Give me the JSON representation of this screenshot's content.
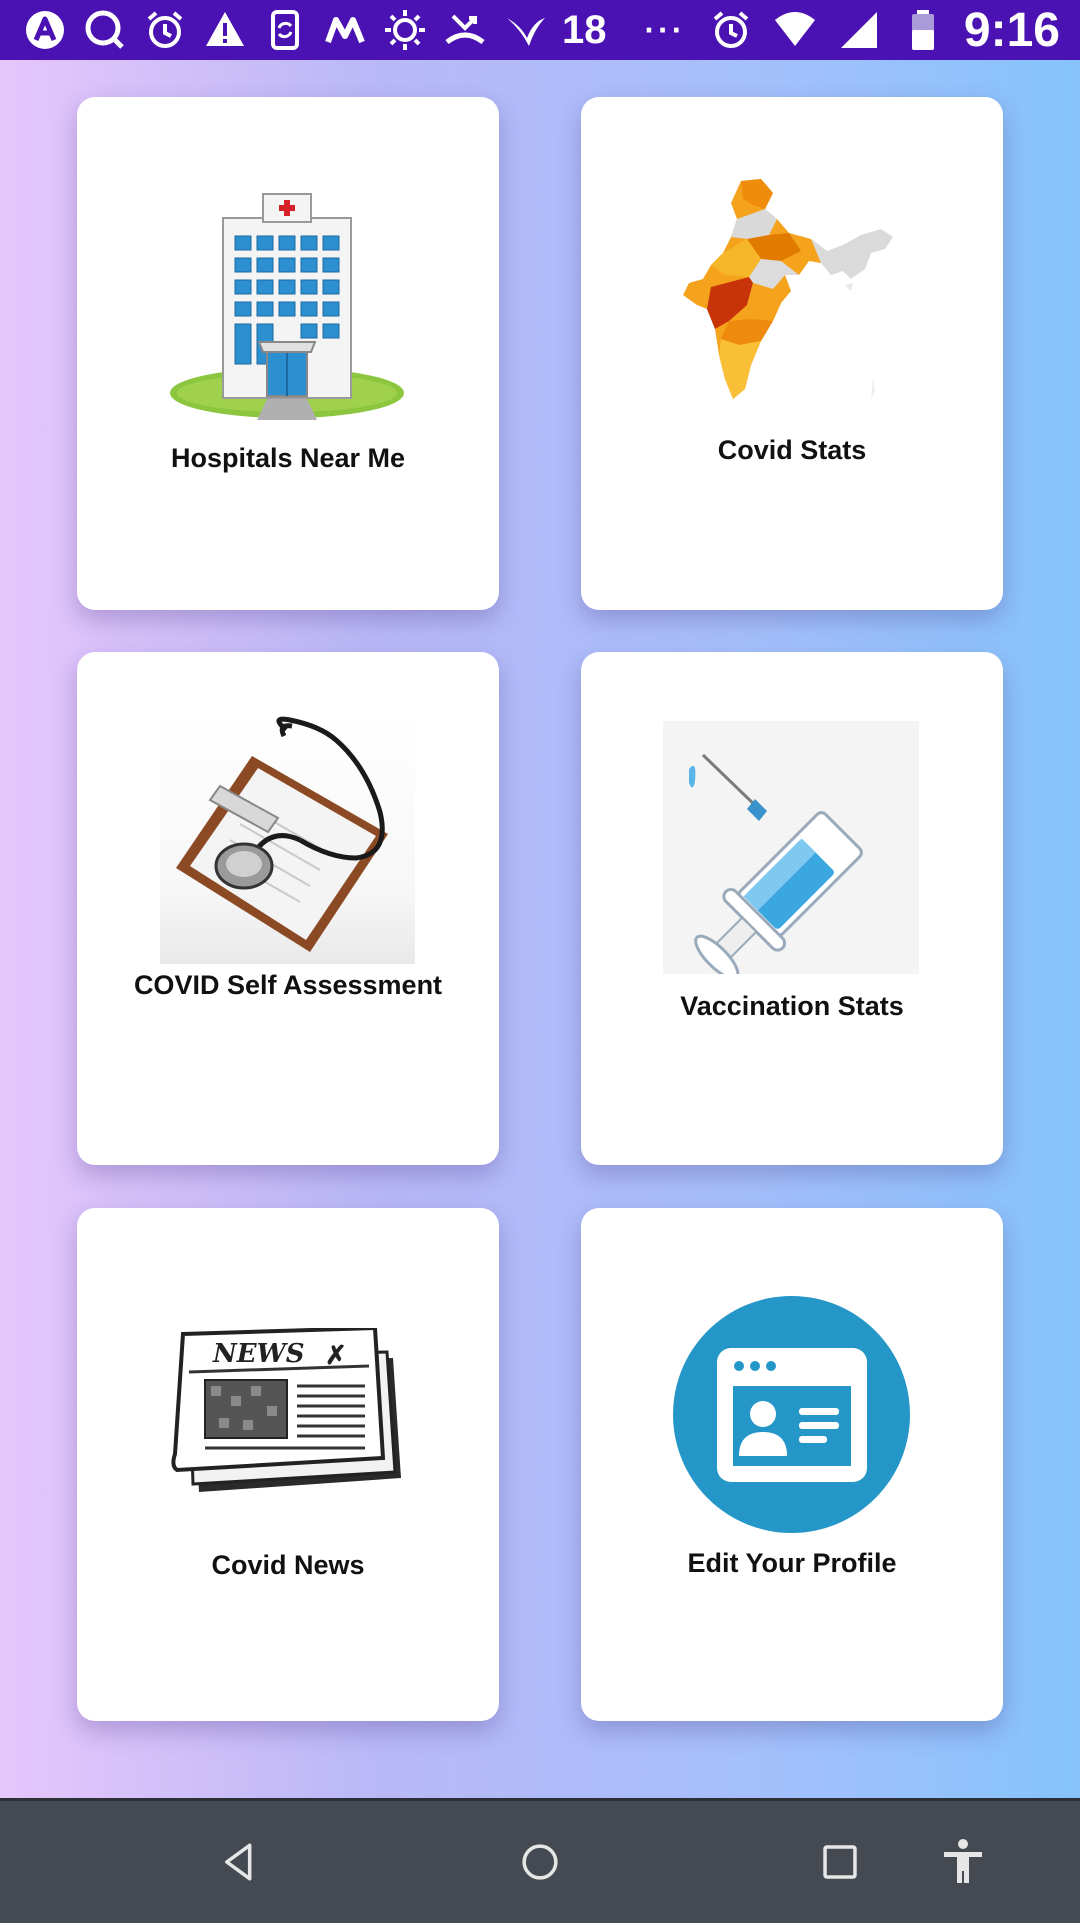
{
  "status_bar": {
    "notification_count": "18",
    "more_indicator": "···",
    "time": "9:16",
    "icons_left": [
      "app-a-icon",
      "search-icon",
      "alarm-icon",
      "warning-icon",
      "phone-sync-icon",
      "m-app-icon",
      "brightness-icon",
      "missed-call-icon",
      "bird-app-icon"
    ],
    "icons_right": [
      "alarm-icon",
      "wifi-icon",
      "signal-icon",
      "battery-icon"
    ]
  },
  "cards": [
    {
      "label": "Hospitals Near Me",
      "icon": "hospital-building-icon"
    },
    {
      "label": "Covid Stats",
      "icon": "india-map-icon"
    },
    {
      "label": "COVID Self Assessment",
      "icon": "clipboard-stethoscope-icon"
    },
    {
      "label": "Vaccination Stats",
      "icon": "syringe-icon"
    },
    {
      "label": "Covid News",
      "icon": "newspaper-icon"
    },
    {
      "label": "Edit Your Profile",
      "icon": "profile-card-icon"
    }
  ],
  "nav_bar": {
    "buttons": [
      "back-icon",
      "home-icon",
      "recents-icon",
      "accessibility-icon"
    ]
  },
  "colors": {
    "status_bar": "#4b12b3",
    "nav_bar": "#454a52",
    "profile_circle": "#2596c8"
  }
}
